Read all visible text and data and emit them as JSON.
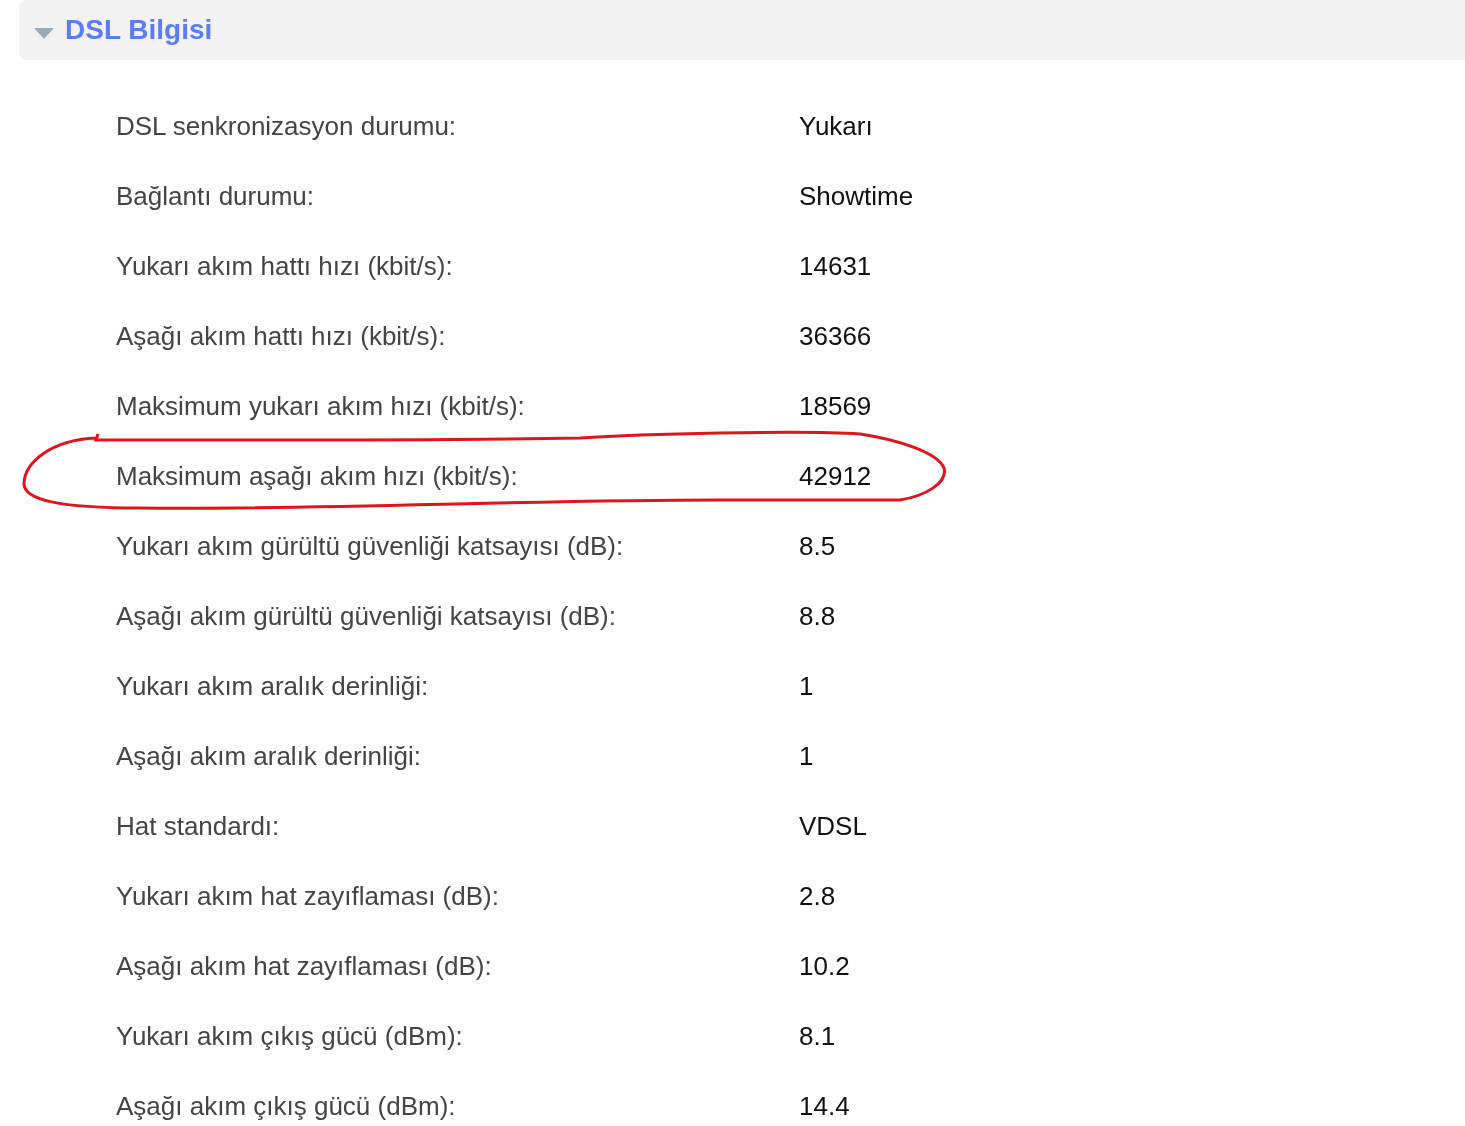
{
  "section": {
    "title": "DSL Bilgisi",
    "expanded": true
  },
  "rows": [
    {
      "label": "DSL senkronizasyon durumu:",
      "value": "Yukarı",
      "circled": false
    },
    {
      "label": "Bağlantı durumu:",
      "value": "Showtime",
      "circled": false
    },
    {
      "label": "Yukarı akım hattı hızı (kbit/s):",
      "value": "14631",
      "circled": false
    },
    {
      "label": "Aşağı akım hattı hızı (kbit/s):",
      "value": "36366",
      "circled": false
    },
    {
      "label": "Maksimum yukarı akım hızı (kbit/s):",
      "value": "18569",
      "circled": false
    },
    {
      "label": "Maksimum aşağı akım hızı (kbit/s):",
      "value": "42912",
      "circled": true
    },
    {
      "label": "Yukarı akım gürültü güvenliği katsayısı (dB):",
      "value": "8.5",
      "circled": false
    },
    {
      "label": "Aşağı akım gürültü güvenliği katsayısı (dB):",
      "value": "8.8",
      "circled": false
    },
    {
      "label": "Yukarı akım aralık derinliği:",
      "value": "1",
      "circled": false
    },
    {
      "label": "Aşağı akım aralık derinliği:",
      "value": "1",
      "circled": false
    },
    {
      "label": "Hat standardı:",
      "value": "VDSL",
      "circled": false
    },
    {
      "label": "Yukarı akım hat zayıflaması (dB):",
      "value": "2.8",
      "circled": false
    },
    {
      "label": "Aşağı akım hat zayıflaması (dB):",
      "value": "10.2",
      "circled": false
    },
    {
      "label": "Yukarı akım çıkış gücü (dBm):",
      "value": "8.1",
      "circled": false
    },
    {
      "label": "Aşağı akım çıkış gücü (dBm):",
      "value": "14.4",
      "circled": false
    }
  ]
}
